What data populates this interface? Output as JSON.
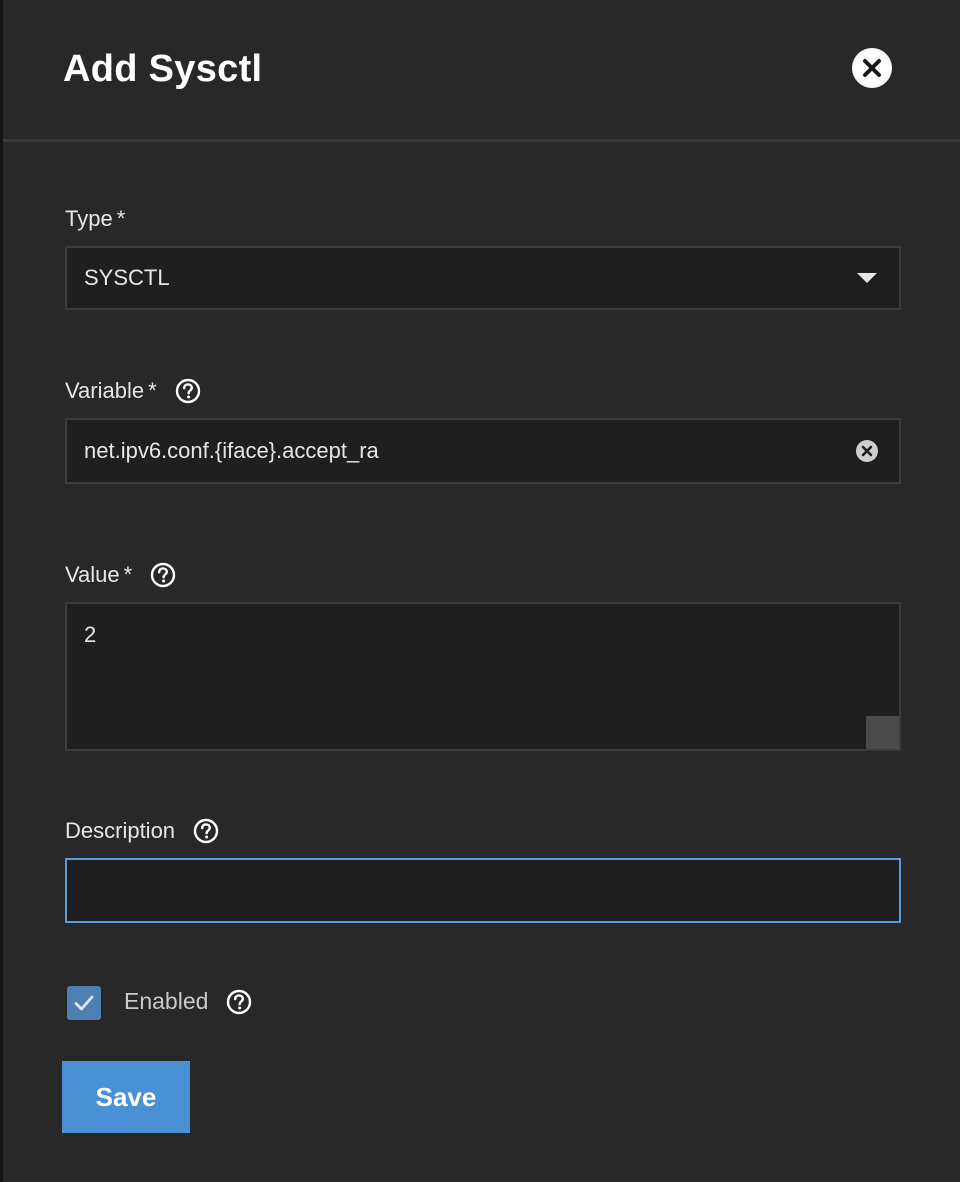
{
  "dialog": {
    "title": "Add Sysctl",
    "close_icon": "close-circle-icon"
  },
  "fields": {
    "type": {
      "label": "Type",
      "required_mark": "*",
      "value": "SYSCTL",
      "icon": "chevron-down-icon"
    },
    "variable": {
      "label": "Variable",
      "required_mark": "*",
      "value": "net.ipv6.conf.{iface}.accept_ra",
      "help_icon": "help-circle-icon",
      "clear_icon": "clear-circle-icon"
    },
    "value": {
      "label": "Value",
      "required_mark": "*",
      "value": "2",
      "help_icon": "help-circle-icon"
    },
    "description": {
      "label": "Description",
      "value": "",
      "help_icon": "help-circle-icon"
    },
    "enabled": {
      "label": "Enabled",
      "checked": true,
      "help_icon": "help-circle-icon"
    }
  },
  "actions": {
    "save_label": "Save"
  },
  "colors": {
    "background": "#282828",
    "field_bg": "#1f1f1f",
    "accent": "#4a90d4",
    "focus_border": "#5b9bd9",
    "checkbox": "#4f7fb0"
  }
}
